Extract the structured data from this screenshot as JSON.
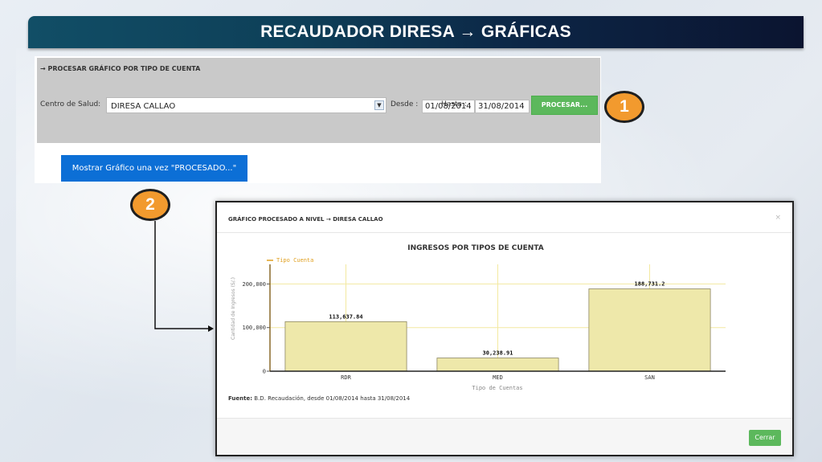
{
  "header": {
    "title": "RECAUDADOR DIRESA → GRÁFICAS"
  },
  "form": {
    "section_title": "→ PROCESAR GRÁFICO POR TIPO DE CUENTA",
    "centro_label": "Centro de Salud:",
    "centro_value": "DIRESA CALLAO",
    "desde_label": "Desde :",
    "desde_value": "01/08/2014",
    "hasta_label": "Hasta :",
    "hasta_value": "31/08/2014",
    "procesar_label": "PROCESAR...",
    "mostrar_label": "Mostrar Gráfico una vez \"PROCESADO...\""
  },
  "callouts": [
    "1",
    "2"
  ],
  "modal": {
    "title": "GRÁFICO PROCESADO A NIVEL → DIRESA CALLAO",
    "close_symbol": "×",
    "fuente_label": "Fuente:",
    "fuente_text": "B.D. Recaudación, desde 01/08/2014 hasta 31/08/2014",
    "cerrar_label": "Cerrar"
  },
  "colors": {
    "header_start": "#114e66",
    "header_end": "#0b1430",
    "procesar_button": "#5cb85c",
    "mostrar_button": "#0c6fd6",
    "callout": "#f29a2e",
    "bar_fill": "#eee8aa",
    "legend_line": "#e0a020"
  },
  "chart_data": {
    "type": "bar",
    "title": "INGRESOS POR TIPOS DE CUENTA",
    "xlabel": "Tipo de Cuentas",
    "ylabel": "Cantidad de Ingresos (S/.)",
    "legend": "Tipo Cuenta",
    "categories": [
      "RDR",
      "MED",
      "SAN"
    ],
    "values": [
      113637.84,
      30238.91,
      188731.2
    ],
    "value_labels": [
      "113,637.84",
      "30,238.91",
      "188,731.2"
    ],
    "yticks": [
      0,
      100000,
      200000
    ],
    "ytick_labels": [
      "0",
      "100,000",
      "200,000"
    ],
    "ylim": [
      0,
      245000
    ],
    "grid": true
  }
}
